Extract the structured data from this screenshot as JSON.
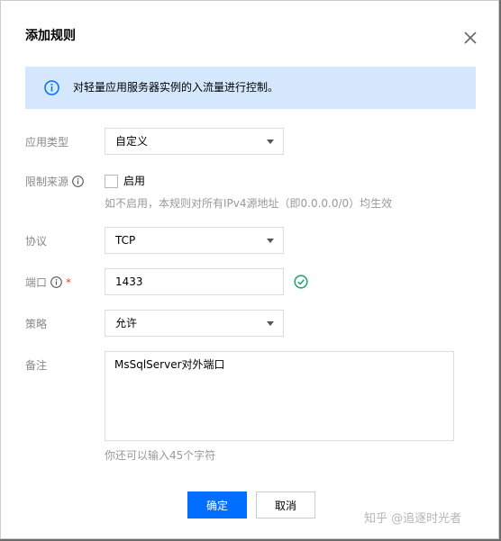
{
  "dialog": {
    "title": "添加规则",
    "info": "对轻量应用服务器实例的入流量进行控制。"
  },
  "form": {
    "app_type": {
      "label": "应用类型",
      "value": "自定义"
    },
    "source_limit": {
      "label": "限制来源",
      "checkbox_label": "启用",
      "checked": false,
      "hint": "如不启用，本规则对所有IPv4源地址（即0.0.0.0/0）均生效"
    },
    "protocol": {
      "label": "协议",
      "value": "TCP"
    },
    "port": {
      "label": "端口",
      "required_mark": "*",
      "value": "1433"
    },
    "policy": {
      "label": "策略",
      "value": "允许"
    },
    "remark": {
      "label": "备注",
      "value": "MsSqlServer对外端口",
      "hint": "你还可以输入45个字符"
    }
  },
  "buttons": {
    "confirm": "确定",
    "cancel": "取消"
  },
  "watermark": "知乎 @追逐时光者",
  "colors": {
    "primary": "#006eff",
    "info_bg": "#d5e7fd",
    "success": "#2ba471",
    "required": "#e54545"
  },
  "icons": {
    "close": "close-icon",
    "info": "info-icon",
    "help": "info-circle-icon",
    "valid": "check-circle-icon",
    "caret": "caret-down-icon"
  }
}
